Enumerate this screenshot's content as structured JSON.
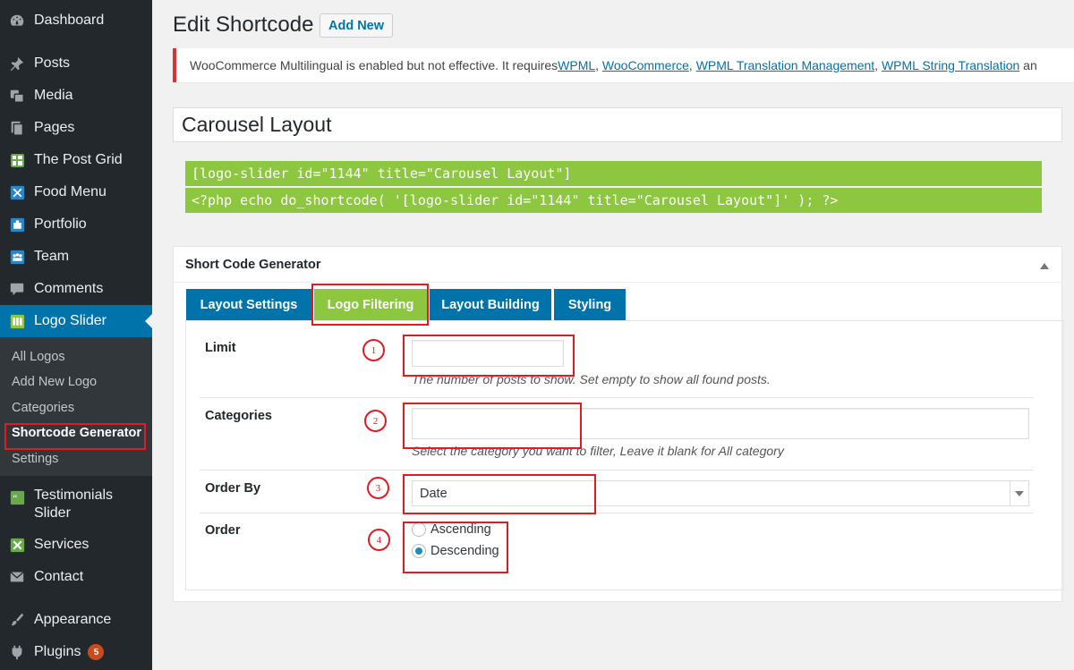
{
  "sidebar": {
    "items": [
      {
        "label": "Dashboard",
        "icon": "dashboard-icon"
      },
      {
        "label": "Posts",
        "icon": "pin-icon"
      },
      {
        "label": "Media",
        "icon": "media-icon"
      },
      {
        "label": "Pages",
        "icon": "pages-icon"
      },
      {
        "label": "The Post Grid",
        "icon": "grid-icon"
      },
      {
        "label": "Food Menu",
        "icon": "food-menu-icon"
      },
      {
        "label": "Portfolio",
        "icon": "portfolio-icon"
      },
      {
        "label": "Team",
        "icon": "team-icon"
      },
      {
        "label": "Comments",
        "icon": "comments-icon"
      },
      {
        "label": "Logo Slider",
        "icon": "logo-slider-icon"
      },
      {
        "label": "Testimonials",
        "label2": "Slider",
        "icon": "testimonials-icon"
      },
      {
        "label": "Services",
        "icon": "services-icon"
      },
      {
        "label": "Contact",
        "icon": "mail-icon"
      },
      {
        "label": "Appearance",
        "icon": "brush-icon"
      },
      {
        "label": "Plugins",
        "icon": "plug-icon",
        "badge": "5"
      }
    ],
    "submenu": [
      "All Logos",
      "Add New Logo",
      "Categories",
      "Shortcode Generator",
      "Settings"
    ]
  },
  "header": {
    "title": "Edit Shortcode",
    "add_new": "Add New"
  },
  "notice": {
    "text": "WooCommerce Multilingual is enabled but not effective. It requires ",
    "links": [
      "WPML",
      "WooCommerce",
      "WPML Translation Management",
      "WPML String Translation"
    ],
    "sep": ", ",
    "tail": " an"
  },
  "post_title": "Carousel Layout",
  "shortcodes": {
    "short": "[logo-slider id=\"1144\" title=\"Carousel Layout\"]",
    "php": "<?php echo do_shortcode( '[logo-slider id=\"1144\" title=\"Carousel Layout\"]' ); ?>"
  },
  "generator": {
    "title": "Short Code Generator",
    "tabs": [
      "Layout Settings",
      "Logo Filtering",
      "Layout Building",
      "Styling"
    ],
    "active_tab": 1,
    "fields": {
      "limit": {
        "label": "Limit",
        "value": "",
        "desc": "The number of posts to show. Set empty to show all found posts."
      },
      "categories": {
        "label": "Categories",
        "value": "",
        "desc": "Select the category you want to filter, Leave it blank for All category"
      },
      "order_by": {
        "label": "Order By",
        "selected": "Date"
      },
      "order": {
        "label": "Order",
        "options": [
          "Ascending",
          "Descending"
        ],
        "selected": "Descending"
      }
    }
  },
  "annotations": [
    "1",
    "2",
    "3",
    "4"
  ],
  "colors": {
    "sidebar_bg": "#23282d",
    "active_blue": "#0073aa",
    "accent_green": "#8dc63f",
    "annotation_red": "#e01b24",
    "notice_red": "#dc3232"
  }
}
